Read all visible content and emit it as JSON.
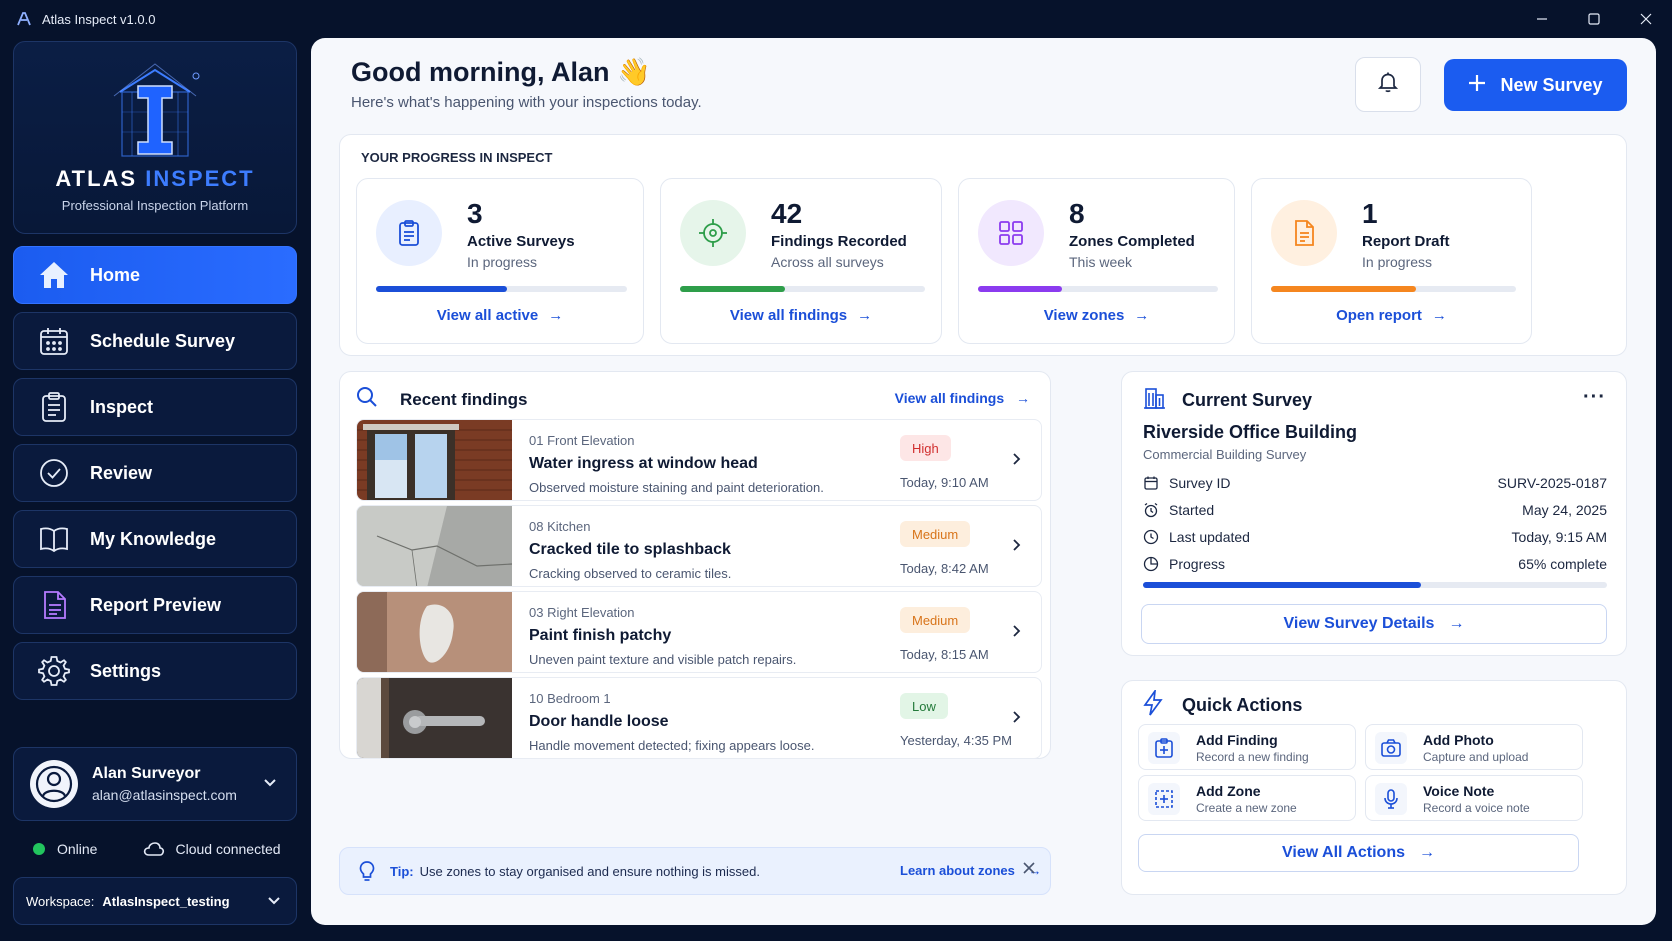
{
  "window": {
    "title": "Atlas Inspect v1.0.0"
  },
  "brand": {
    "name_main": "ATLAS",
    "name_accent": "INSPECT",
    "tagline": "Professional Inspection Platform"
  },
  "nav": {
    "items": [
      {
        "label": "Home",
        "icon": "home-icon",
        "active": true
      },
      {
        "label": "Schedule Survey",
        "icon": "calendar-icon",
        "active": false
      },
      {
        "label": "Inspect",
        "icon": "clipboard-icon",
        "active": false
      },
      {
        "label": "Review",
        "icon": "check-circle-icon",
        "active": false
      },
      {
        "label": "My Knowledge",
        "icon": "book-icon",
        "active": false
      },
      {
        "label": "Report Preview",
        "icon": "document-icon",
        "active": false
      },
      {
        "label": "Settings",
        "icon": "gear-icon",
        "active": false
      }
    ]
  },
  "user": {
    "name": "Alan Surveyor",
    "email": "alan@atlasinspect.com"
  },
  "status": {
    "online": "Online",
    "cloud": "Cloud connected"
  },
  "workspace": {
    "label": "Workspace:",
    "value": "AtlasInspect_testing"
  },
  "header": {
    "greeting": "Good morning, Alan 👋",
    "subtitle": "Here's what's happening with your inspections today.",
    "new_button": "New Survey"
  },
  "progress": {
    "title": "YOUR PROGRESS IN INSPECT",
    "cards": [
      {
        "value": "3",
        "label": "Active Surveys",
        "sub": "In progress",
        "link": "View all active",
        "fill": 0.52,
        "color": "#1b4fd8",
        "bg": "#e8efff",
        "icon": "clipboard-icon"
      },
      {
        "value": "42",
        "label": "Findings Recorded",
        "sub": "Across all surveys",
        "link": "View all findings",
        "fill": 0.43,
        "color": "#2e9e4a",
        "bg": "#e6f5ea",
        "icon": "target-icon"
      },
      {
        "value": "8",
        "label": "Zones Completed",
        "sub": "This week",
        "link": "View zones",
        "fill": 0.35,
        "color": "#8b3bef",
        "bg": "#f1e8fe",
        "icon": "grid-icon"
      },
      {
        "value": "1",
        "label": "Report Draft",
        "sub": "In progress",
        "link": "Open report",
        "fill": 0.59,
        "color": "#f5861f",
        "bg": "#fff0e0",
        "icon": "document-icon"
      }
    ]
  },
  "findings": {
    "title": "Recent findings",
    "view_all": "View all findings",
    "rows": [
      {
        "zone": "01 Front Elevation",
        "title": "Water ingress at window head",
        "desc": "Observed moisture staining and paint deterioration.",
        "severity": "High",
        "time": "Today, 9:10 AM",
        "thumb": "window-photo"
      },
      {
        "zone": "08 Kitchen",
        "title": "Cracked tile to splashback",
        "desc": "Cracking observed to ceramic tiles.",
        "severity": "Medium",
        "time": "Today, 8:42 AM",
        "thumb": "tile-photo"
      },
      {
        "zone": "03 Right Elevation",
        "title": "Paint finish patchy",
        "desc": "Uneven paint texture and visible patch repairs.",
        "severity": "Medium",
        "time": "Today, 8:15 AM",
        "thumb": "wall-photo"
      },
      {
        "zone": "10 Bedroom 1",
        "title": "Door handle loose",
        "desc": "Handle movement detected; fixing appears loose.",
        "severity": "Low",
        "time": "Yesterday, 4:35 PM",
        "thumb": "door-photo"
      }
    ]
  },
  "tip": {
    "label": "Tip:",
    "text": "Use zones to stay organised and ensure nothing is missed.",
    "link": "Learn about zones"
  },
  "survey": {
    "title": "Current Survey",
    "name": "Riverside Office Building",
    "type": "Commercial Building Survey",
    "meta": [
      {
        "label": "Survey ID",
        "value": "SURV-2025-0187",
        "icon": "calendar-icon"
      },
      {
        "label": "Started",
        "value": "May 24, 2025",
        "icon": "alarm-icon"
      },
      {
        "label": "Last updated",
        "value": "Today, 9:15 AM",
        "icon": "clock-icon"
      },
      {
        "label": "Progress",
        "value": "65% complete",
        "icon": "pie-icon"
      }
    ],
    "progress": 0.6,
    "button": "View Survey Details"
  },
  "quick": {
    "title": "Quick Actions",
    "actions": [
      {
        "title": "Add Finding",
        "sub": "Record a new finding",
        "icon": "add-finding-icon"
      },
      {
        "title": "Add Photo",
        "sub": "Capture and upload",
        "icon": "camera-icon"
      },
      {
        "title": "Add Zone",
        "sub": "Create a new zone",
        "icon": "add-zone-icon"
      },
      {
        "title": "Voice Note",
        "sub": "Record a voice note",
        "icon": "microphone-icon"
      }
    ],
    "button": "View All Actions"
  }
}
